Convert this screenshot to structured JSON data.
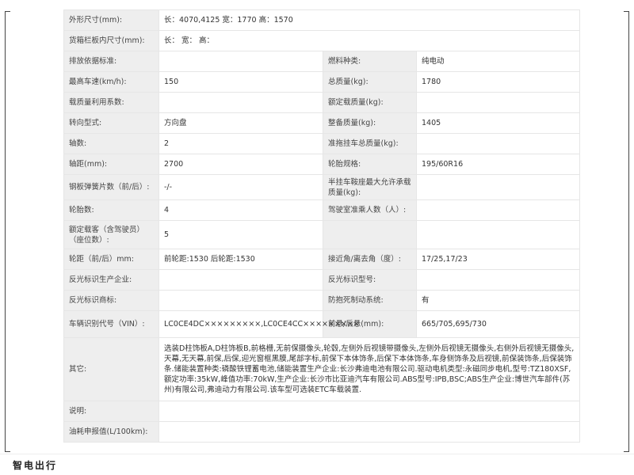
{
  "rows": [
    {
      "type": "wide",
      "h": 26,
      "label": "外形尺寸(mm):",
      "value": "长：4070,4125 宽：1770 高：1570"
    },
    {
      "type": "wide",
      "h": 26,
      "label": "货箱栏板内尺寸(mm):",
      "value": "长： 宽： 高："
    },
    {
      "type": "pair",
      "h": 26,
      "l1": "排放依据标准:",
      "v1": "",
      "l2": "燃料种类:",
      "v2": "纯电动"
    },
    {
      "type": "pair",
      "h": 26,
      "l1": "最高车速(km/h):",
      "v1": "150",
      "l2": "总质量(kg):",
      "v2": "1780"
    },
    {
      "type": "pair",
      "h": 26,
      "l1": "载质量利用系数:",
      "v1": "",
      "l2": "额定载质量(kg):",
      "v2": ""
    },
    {
      "type": "pair",
      "h": 26,
      "l1": "转向型式:",
      "v1": "方向盘",
      "l2": "整备质量(kg):",
      "v2": "1405"
    },
    {
      "type": "pair",
      "h": 26,
      "l1": "轴数:",
      "v1": "2",
      "l2": "准拖挂车总质量(kg):",
      "v2": ""
    },
    {
      "type": "pair",
      "h": 26,
      "l1": "轴距(mm):",
      "v1": "2700",
      "l2": "轮胎规格:",
      "v2": "195/60R16"
    },
    {
      "type": "pair",
      "h": 32,
      "l1": "钢板弹簧片数（前/后）:",
      "v1": "-/-",
      "l2": "半挂车鞍座最大允许承载质量(kg):",
      "v2": ""
    },
    {
      "type": "pair",
      "h": 26,
      "l1": "轮胎数:",
      "v1": "4",
      "l2": "驾驶室准乘人数（人）:",
      "v2": ""
    },
    {
      "type": "pair",
      "h": 36,
      "l1": "额定载客（含驾驶员）（座位数）:",
      "v1": "5",
      "l2": "",
      "v2": ""
    },
    {
      "type": "pair",
      "h": 26,
      "l1": "轮距（前/后）mm:",
      "v1": "前轮距:1530 后轮距:1530",
      "l2": "接近角/离去角（度）:",
      "v2": "17/25,17/23"
    },
    {
      "type": "pair",
      "h": 26,
      "l1": "反光标识生产企业:",
      "v1": "",
      "l2": "反光标识型号:",
      "v2": ""
    },
    {
      "type": "pair",
      "h": 26,
      "l1": "反光标识商标:",
      "v1": "",
      "l2": "防抱死制动系统:",
      "v2": "有"
    },
    {
      "type": "pair",
      "h": 34,
      "l1": "车辆识别代号（VIN）:",
      "v1": "LC0CE4DC×××××××××,LC0CE4CC×××××××××",
      "l2": "前悬/后悬(mm):",
      "v2": "665/705,695/730"
    },
    {
      "type": "wide",
      "h": 80,
      "label": "其它:",
      "value": "选装D柱饰板A,D柱饰板B,前格栅,无前保摄像头,轮毂,左侧外后视镜带摄像头,左侧外后视镜无摄像头,右侧外后视镜无摄像头,天幕,无天幕,前保,后保,迎光窗框黑膜,尾部字标,前保下本体饰条,后保下本体饰条,车身侧饰条及后视镜,前保装饰条,后保装饰条.储能装置种类:磷酸铁锂蓄电池,储能装置生产企业:长沙弗迪电池有限公司.驱动电机类型:永磁同步电机,型号:TZ180XSF,额定功率:35kW,峰值功率:70kW,生产企业:长沙市比亚迪汽车有限公司.ABS型号:IPB,BSC;ABS生产企业:博世汽车部件(苏州)有限公司,弗迪动力有限公司.该车型可选装ETC车载装置."
    },
    {
      "type": "wide",
      "h": 26,
      "label": "说明:",
      "value": ""
    },
    {
      "type": "wide",
      "h": 26,
      "label": "油耗申报值(L/100km):",
      "value": ""
    }
  ],
  "footer": {
    "brand": "智电出行"
  }
}
